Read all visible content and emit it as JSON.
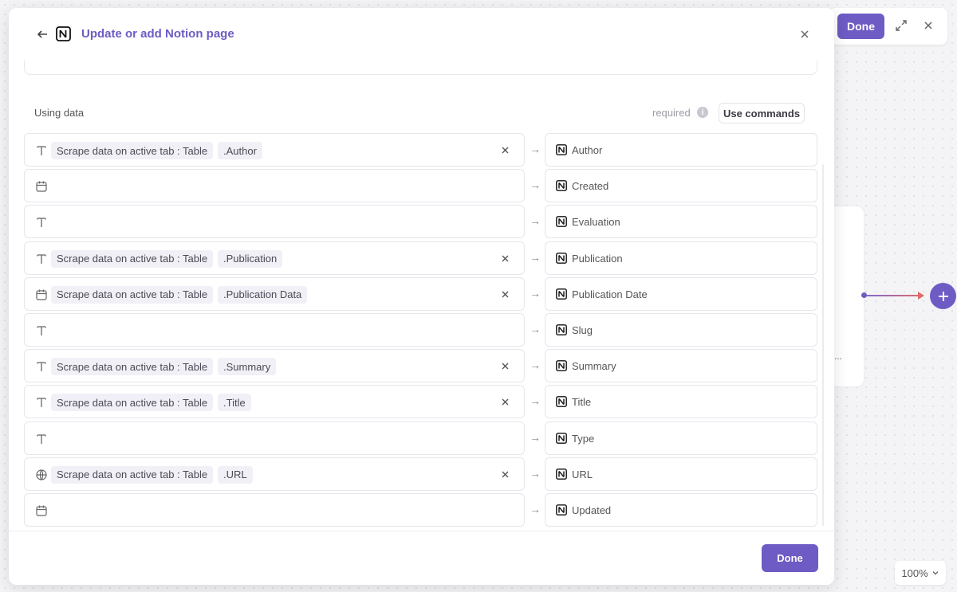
{
  "canvas": {
    "done_label": "Done",
    "zoom_label": "100%",
    "node_menu": "..."
  },
  "modal": {
    "title": "Update or add Notion page",
    "using_data_label": "Using data",
    "required_label": "required",
    "info_glyph": "i",
    "use_commands_label": "Use commands",
    "done_label": "Done",
    "arrow_glyph": "→",
    "rows": [
      {
        "type_icon": "text-icon",
        "source": "Scrape data on active tab : Table",
        "field": ".Author",
        "target": "Author"
      },
      {
        "type_icon": "calendar-icon",
        "source": "",
        "field": "",
        "target": "Created"
      },
      {
        "type_icon": "text-icon",
        "source": "",
        "field": "",
        "target": "Evaluation"
      },
      {
        "type_icon": "text-icon",
        "source": "Scrape data on active tab : Table",
        "field": ".Publication",
        "target": "Publication"
      },
      {
        "type_icon": "calendar-icon",
        "source": "Scrape data on active tab : Table",
        "field": ".Publication Data",
        "target": "Publication Date"
      },
      {
        "type_icon": "text-icon",
        "source": "",
        "field": "",
        "target": "Slug"
      },
      {
        "type_icon": "text-icon",
        "source": "Scrape data on active tab : Table",
        "field": ".Summary",
        "target": "Summary"
      },
      {
        "type_icon": "text-icon",
        "source": "Scrape data on active tab : Table",
        "field": ".Title",
        "target": "Title"
      },
      {
        "type_icon": "text-icon",
        "source": "",
        "field": "",
        "target": "Type"
      },
      {
        "type_icon": "globe-icon",
        "source": "Scrape data on active tab : Table",
        "field": ".URL",
        "target": "URL"
      },
      {
        "type_icon": "calendar-icon",
        "source": "",
        "field": "",
        "target": "Updated"
      }
    ]
  },
  "colors": {
    "accent": "#6e5bc4",
    "chip_bg": "#f1f0f7"
  }
}
